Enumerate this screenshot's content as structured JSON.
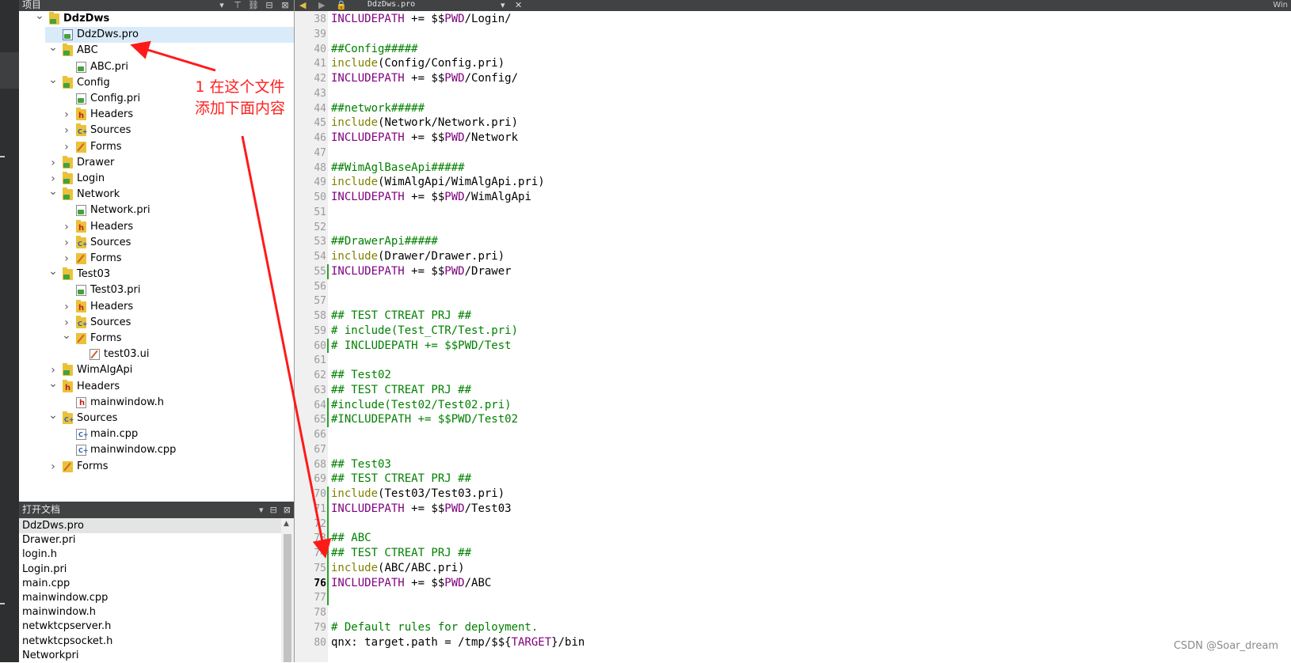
{
  "project_pane": {
    "title": "项目",
    "tools": [
      "▾",
      "⊤",
      "⛓",
      "⊟",
      "⊠"
    ]
  },
  "editor_toolbar": {
    "back": "◀",
    "forward": "▶",
    "lock": "🔒",
    "file_name": "DdzDws.pro",
    "dropdown": "▾",
    "close": "✕",
    "right_text": "Win"
  },
  "tree": [
    {
      "label": "DdzDws",
      "depth": 0,
      "arrow": "down",
      "icon": "project-folder-icon",
      "bold": true
    },
    {
      "label": "DdzDws.pro",
      "depth": 1,
      "arrow": "",
      "icon": "pro-file-icon",
      "selected": true
    },
    {
      "label": "ABC",
      "depth": 1,
      "arrow": "down",
      "icon": "folder-icon"
    },
    {
      "label": "ABC.pri",
      "depth": 2,
      "arrow": "",
      "icon": "pri-file-icon"
    },
    {
      "label": "Config",
      "depth": 1,
      "arrow": "down",
      "icon": "folder-icon"
    },
    {
      "label": "Config.pri",
      "depth": 2,
      "arrow": "",
      "icon": "pri-file-icon"
    },
    {
      "label": "Headers",
      "depth": 2,
      "arrow": "right",
      "icon": "headers-folder-icon"
    },
    {
      "label": "Sources",
      "depth": 2,
      "arrow": "right",
      "icon": "sources-folder-icon"
    },
    {
      "label": "Forms",
      "depth": 2,
      "arrow": "right",
      "icon": "forms-folder-icon"
    },
    {
      "label": "Drawer",
      "depth": 1,
      "arrow": "right",
      "icon": "folder-icon"
    },
    {
      "label": "Login",
      "depth": 1,
      "arrow": "right",
      "icon": "folder-icon"
    },
    {
      "label": "Network",
      "depth": 1,
      "arrow": "down",
      "icon": "folder-icon"
    },
    {
      "label": "Network.pri",
      "depth": 2,
      "arrow": "",
      "icon": "pri-file-icon"
    },
    {
      "label": "Headers",
      "depth": 2,
      "arrow": "right",
      "icon": "headers-folder-icon"
    },
    {
      "label": "Sources",
      "depth": 2,
      "arrow": "right",
      "icon": "sources-folder-icon"
    },
    {
      "label": "Forms",
      "depth": 2,
      "arrow": "right",
      "icon": "forms-folder-icon"
    },
    {
      "label": "Test03",
      "depth": 1,
      "arrow": "down",
      "icon": "folder-icon"
    },
    {
      "label": "Test03.pri",
      "depth": 2,
      "arrow": "",
      "icon": "pri-file-icon"
    },
    {
      "label": "Headers",
      "depth": 2,
      "arrow": "right",
      "icon": "headers-folder-icon"
    },
    {
      "label": "Sources",
      "depth": 2,
      "arrow": "right",
      "icon": "sources-folder-icon"
    },
    {
      "label": "Forms",
      "depth": 2,
      "arrow": "down",
      "icon": "forms-folder-icon"
    },
    {
      "label": "test03.ui",
      "depth": 3,
      "arrow": "",
      "icon": "ui-file-icon"
    },
    {
      "label": "WimAlgApi",
      "depth": 1,
      "arrow": "right",
      "icon": "folder-icon"
    },
    {
      "label": "Headers",
      "depth": 1,
      "arrow": "down",
      "icon": "headers-folder-icon"
    },
    {
      "label": "mainwindow.h",
      "depth": 2,
      "arrow": "",
      "icon": "header-file-icon"
    },
    {
      "label": "Sources",
      "depth": 1,
      "arrow": "down",
      "icon": "sources-folder-icon"
    },
    {
      "label": "main.cpp",
      "depth": 2,
      "arrow": "",
      "icon": "cpp-file-icon"
    },
    {
      "label": "mainwindow.cpp",
      "depth": 2,
      "arrow": "",
      "icon": "cpp-file-icon"
    },
    {
      "label": "Forms",
      "depth": 1,
      "arrow": "right",
      "icon": "forms-folder-icon"
    }
  ],
  "open_documents": {
    "title": "打开文档",
    "tools": [
      "▾",
      "⊟",
      "⊠"
    ],
    "items": [
      {
        "label": "DdzDws.pro",
        "selected": true
      },
      {
        "label": "Drawer.pri"
      },
      {
        "label": "login.h"
      },
      {
        "label": "Login.pri"
      },
      {
        "label": "main.cpp"
      },
      {
        "label": "mainwindow.cpp"
      },
      {
        "label": "mainwindow.h"
      },
      {
        "label": "netwktcpserver.h"
      },
      {
        "label": "netwktcpsocket.h"
      },
      {
        "label": "Networkpri"
      }
    ]
  },
  "editor": {
    "current_line": 76,
    "lines": [
      {
        "n": "38",
        "t": [
          [
            "v",
            "INCLUDEPATH"
          ],
          [
            "p",
            " += $$"
          ],
          [
            "vr",
            "PWD"
          ],
          [
            "p",
            "/Login/"
          ]
        ]
      },
      {
        "n": "39",
        "t": []
      },
      {
        "n": "40",
        "t": [
          [
            "cm",
            "##Config#####"
          ]
        ]
      },
      {
        "n": "41",
        "t": [
          [
            "kw",
            "include"
          ],
          [
            "p",
            "(Config/Config.pri)"
          ]
        ]
      },
      {
        "n": "42",
        "t": [
          [
            "v",
            "INCLUDEPATH"
          ],
          [
            "p",
            " += $$"
          ],
          [
            "vr",
            "PWD"
          ],
          [
            "p",
            "/Config/"
          ]
        ]
      },
      {
        "n": "43",
        "t": []
      },
      {
        "n": "44",
        "t": [
          [
            "cm",
            "##network#####"
          ]
        ]
      },
      {
        "n": "45",
        "t": [
          [
            "kw",
            "include"
          ],
          [
            "p",
            "(Network/Network.pri)"
          ]
        ]
      },
      {
        "n": "46",
        "t": [
          [
            "v",
            "INCLUDEPATH"
          ],
          [
            "p",
            " += $$"
          ],
          [
            "vr",
            "PWD"
          ],
          [
            "p",
            "/Network"
          ]
        ]
      },
      {
        "n": "47",
        "t": []
      },
      {
        "n": "48",
        "t": [
          [
            "cm",
            "##WimAglBaseApi#####"
          ]
        ]
      },
      {
        "n": "49",
        "t": [
          [
            "kw",
            "include"
          ],
          [
            "p",
            "(WimAlgApi/WimAlgApi.pri)"
          ]
        ]
      },
      {
        "n": "50",
        "t": [
          [
            "v",
            "INCLUDEPATH"
          ],
          [
            "p",
            " += $$"
          ],
          [
            "vr",
            "PWD"
          ],
          [
            "p",
            "/WimAlgApi"
          ]
        ]
      },
      {
        "n": "51",
        "t": []
      },
      {
        "n": "52",
        "t": []
      },
      {
        "n": "53",
        "t": [
          [
            "cm",
            "##DrawerApi#####"
          ]
        ]
      },
      {
        "n": "54",
        "t": [
          [
            "kw",
            "include"
          ],
          [
            "p",
            "(Drawer/Drawer.pri)"
          ]
        ]
      },
      {
        "n": "55",
        "t": [
          [
            "v",
            "INCLUDEPATH"
          ],
          [
            "p",
            " += $$"
          ],
          [
            "vr",
            "PWD"
          ],
          [
            "p",
            "/Drawer"
          ]
        ]
      },
      {
        "n": "56",
        "t": []
      },
      {
        "n": "57",
        "t": []
      },
      {
        "n": "58",
        "t": [
          [
            "cm",
            "## TEST CTREAT PRJ ##"
          ]
        ]
      },
      {
        "n": "59",
        "t": [
          [
            "cm",
            "# include(Test_CTR/Test.pri)"
          ]
        ]
      },
      {
        "n": "60",
        "t": [
          [
            "cm",
            "# INCLUDEPATH += $$PWD/Test"
          ]
        ]
      },
      {
        "n": "61",
        "t": []
      },
      {
        "n": "62",
        "t": [
          [
            "cm",
            "## Test02"
          ]
        ]
      },
      {
        "n": "63",
        "t": [
          [
            "cm",
            "## TEST CTREAT PRJ ##"
          ]
        ]
      },
      {
        "n": "64",
        "t": [
          [
            "cm",
            "#include(Test02/Test02.pri)"
          ]
        ]
      },
      {
        "n": "65",
        "t": [
          [
            "cm",
            "#INCLUDEPATH += $$PWD/Test02"
          ]
        ]
      },
      {
        "n": "66",
        "t": []
      },
      {
        "n": "67",
        "t": []
      },
      {
        "n": "68",
        "t": [
          [
            "cm",
            "## Test03"
          ]
        ]
      },
      {
        "n": "69",
        "t": [
          [
            "cm",
            "## TEST CTREAT PRJ ##"
          ]
        ]
      },
      {
        "n": "70",
        "t": [
          [
            "kw",
            "include"
          ],
          [
            "p",
            "(Test03/Test03.pri)"
          ]
        ]
      },
      {
        "n": "71",
        "t": [
          [
            "v",
            "INCLUDEPATH"
          ],
          [
            "p",
            " += $$"
          ],
          [
            "vr",
            "PWD"
          ],
          [
            "p",
            "/Test03"
          ]
        ]
      },
      {
        "n": "72",
        "t": []
      },
      {
        "n": "73",
        "t": [
          [
            "cm",
            "## ABC"
          ]
        ]
      },
      {
        "n": "74",
        "t": [
          [
            "cm",
            "## TEST CTREAT PRJ ##"
          ]
        ]
      },
      {
        "n": "75",
        "t": [
          [
            "kw",
            "include"
          ],
          [
            "p",
            "(ABC/ABC.pri)"
          ]
        ]
      },
      {
        "n": "76",
        "t": [
          [
            "v",
            "INCLUDEPATH"
          ],
          [
            "p",
            " += $$"
          ],
          [
            "vr",
            "PWD"
          ],
          [
            "p",
            "/ABC"
          ]
        ]
      },
      {
        "n": "77",
        "t": []
      },
      {
        "n": "78",
        "t": []
      },
      {
        "n": "79",
        "t": [
          [
            "cm",
            "# Default rules for deployment."
          ]
        ]
      },
      {
        "n": "80",
        "t": [
          [
            "p",
            "qnx: target.path = /tmp/$${"
          ],
          [
            "vr",
            "TARGET"
          ],
          [
            "p",
            "}/bin"
          ]
        ]
      }
    ]
  },
  "annotation": {
    "line1": "1 在这个文件",
    "line2": "添加下面内容",
    "color": "#ff2020"
  },
  "watermark": "CSDN @Soar_dream"
}
